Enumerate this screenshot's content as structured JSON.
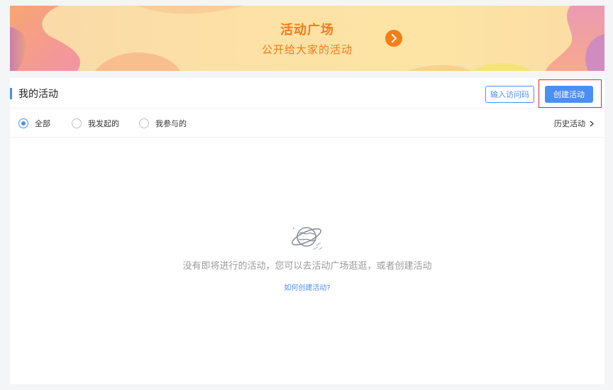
{
  "banner": {
    "title": "活动广场",
    "subtitle": "公开给大家的活动"
  },
  "header": {
    "title": "我的活动",
    "access_code_label": "输入访问码",
    "create_label": "创建活动"
  },
  "filters": {
    "options": [
      {
        "label": "全部",
        "selected": true
      },
      {
        "label": "我发起的",
        "selected": false
      },
      {
        "label": "我参与的",
        "selected": false
      }
    ],
    "history_label": "历史活动"
  },
  "empty_state": {
    "icon": "planet-icon",
    "message": "没有即将进行的活动，您可以去活动广场逛逛，或者创建活动",
    "help_link": "如何创建活动?"
  },
  "colors": {
    "accent": "#4b8ff1",
    "banner_text": "#f27b1d",
    "highlight_border": "#e1292b"
  }
}
